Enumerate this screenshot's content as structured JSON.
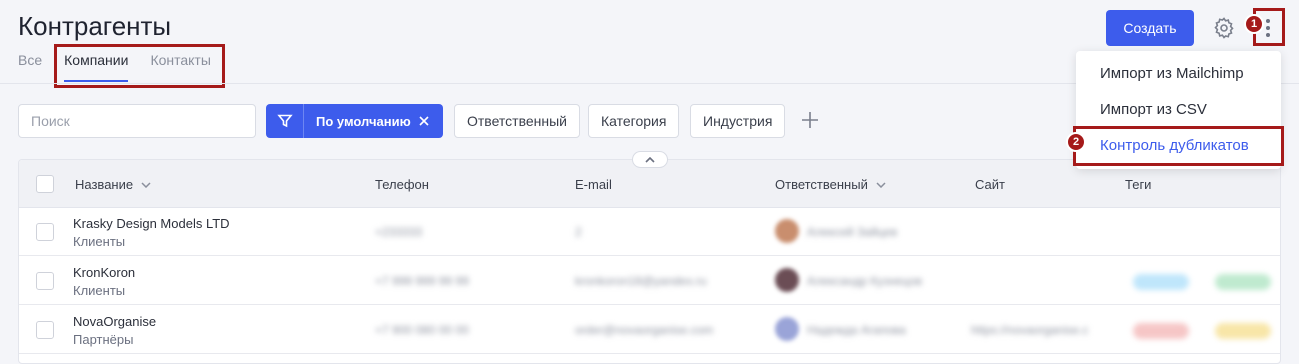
{
  "header": {
    "title": "Контрагенты",
    "tabs": [
      {
        "label": "Все",
        "active": false
      },
      {
        "label": "Компании",
        "active": true
      },
      {
        "label": "Контакты",
        "active": false
      }
    ],
    "create_label": "Создать"
  },
  "annotations": {
    "one": "1",
    "two": "2"
  },
  "menu": {
    "items": [
      "Импорт из Mailchimp",
      "Импорт из CSV",
      "Контроль дубликатов"
    ]
  },
  "filters": {
    "search_placeholder": "Поиск",
    "active_filter": "По умолчанию",
    "chips": [
      "Ответственный",
      "Категория",
      "Индустрия"
    ]
  },
  "table": {
    "columns": [
      "Название",
      "Телефон",
      "E-mail",
      "Ответственный",
      "Сайт",
      "Теги"
    ],
    "rows": [
      {
        "name": "Krasky Design Models LTD",
        "category": "Клиенты",
        "phone": "+233333",
        "email": "2",
        "owner": "Алексей Зайцев",
        "site": ""
      },
      {
        "name": "KronKoron",
        "category": "Клиенты",
        "phone": "+7 999 999 99 99",
        "email": "kronkoron18@yandex.ru",
        "owner": "Александр Кузнецов",
        "site": ""
      },
      {
        "name": "NovaOrganise",
        "category": "Партнёры",
        "phone": "+7 900 080 00 00",
        "email": "order@novaorganise.com",
        "owner": "Надежда Агапова",
        "site": "https://novaorganise.c"
      }
    ]
  },
  "colors": {
    "accent": "#3d5cec",
    "annotation": "#a51a1a"
  }
}
